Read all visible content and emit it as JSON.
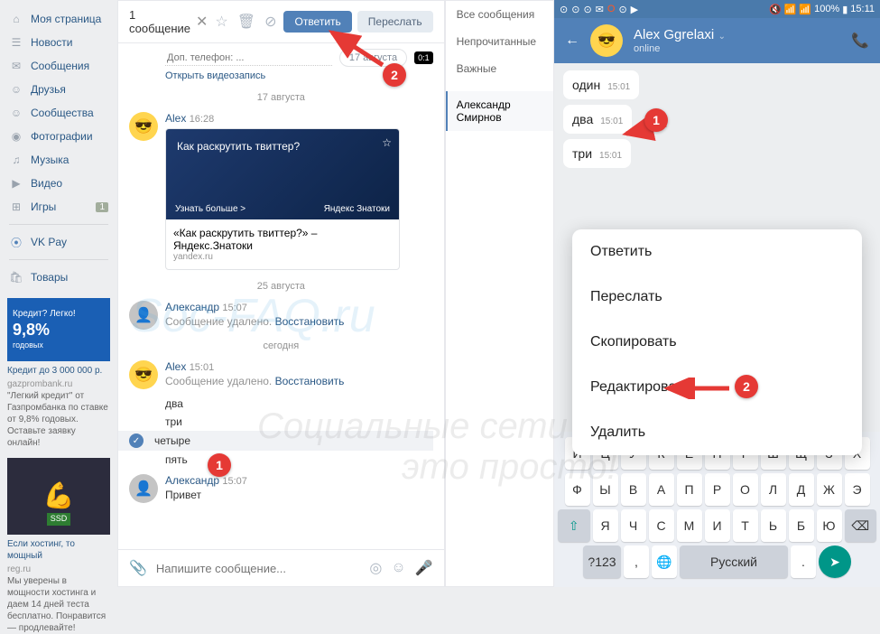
{
  "sidebar": {
    "items": [
      {
        "icon": "home",
        "label": "Моя страница"
      },
      {
        "icon": "news",
        "label": "Новости"
      },
      {
        "icon": "msg",
        "label": "Сообщения"
      },
      {
        "icon": "friends",
        "label": "Друзья"
      },
      {
        "icon": "groups",
        "label": "Сообщества"
      },
      {
        "icon": "photo",
        "label": "Фотографии"
      },
      {
        "icon": "music",
        "label": "Музыка"
      },
      {
        "icon": "video",
        "label": "Видео"
      },
      {
        "icon": "games",
        "label": "Игры",
        "badge": "1"
      }
    ],
    "vkpay": "VK Pay",
    "goods": "Товары"
  },
  "ad1": {
    "badge_top": "Кредит? Легко!",
    "badge_rate": "9,8%",
    "badge_sub": "годовых",
    "title": "Кредит до 3 000 000 р.",
    "domain": "gazprombank.ru",
    "text": "\"Легкий кредит\" от Газпромбанка по ставке от 9,8% годовых. Оставьте заявку онлайн!"
  },
  "ad2": {
    "ssd": "SSD",
    "title": "Если хостинг, то мощный",
    "domain": "reg.ru",
    "text": "Мы уверены в мощности хостинга и даем 14 дней теста бесплатно. Понравится — продлевайте!"
  },
  "topbar": {
    "title": "1 сообщение",
    "reply": "Ответить",
    "forward": "Переслать"
  },
  "phone_placeholder": "Доп. телефон: ...",
  "date_chip": "17 августа",
  "video_link": "Открыть видеозапись",
  "date1": "17 августа",
  "date2": "25 августа",
  "date3": "сегодня",
  "alex": "Alex",
  "alexander": "Александр",
  "t1628": "16:28",
  "t1507": "15:07",
  "t1501": "15:01",
  "card": {
    "headline": "Как раскрутить твиттер?",
    "more": "Узнать больше >",
    "brand": "Яндекс Знатоки",
    "title": "«Как раскрутить твиттер?» – Яндекс.Знатоки",
    "domain": "yandex.ru"
  },
  "deleted": "Сообщение удалено.",
  "restore": "Восстановить",
  "m_dva": "два",
  "m_tri": "три",
  "m_chetyre": "четыре",
  "m_pyat": "пять",
  "m_privet": "Привет",
  "composer_placeholder": "Напишите сообщение...",
  "rp": {
    "all": "Все сообщения",
    "unread": "Непрочитанные",
    "important": "Важные",
    "name": "Александр Смирнов"
  },
  "mobile": {
    "battery": "100%",
    "time": "15:11",
    "name": "Alex Ggrelaxi",
    "status": "online",
    "b1": "один",
    "b2": "два",
    "b3": "три",
    "bt": "15:01",
    "menu": [
      "Ответить",
      "Переслать",
      "Скопировать",
      "Редактировать",
      "Удалить"
    ],
    "kb_row1": [
      "Й",
      "Ц",
      "У",
      "К",
      "Е",
      "Н",
      "Г",
      "Ш",
      "Щ",
      "З",
      "Х"
    ],
    "kb_row2": [
      "Ф",
      "Ы",
      "В",
      "А",
      "П",
      "Р",
      "О",
      "Л",
      "Д",
      "Ж",
      "Э"
    ],
    "kb_row3": [
      "Я",
      "Ч",
      "С",
      "М",
      "И",
      "Т",
      "Ь",
      "Б",
      "Ю"
    ],
    "k123": "?123",
    "lang": "Русский",
    "comma": ",",
    "dot": "."
  },
  "wm1": "Soc-FAQ.ru",
  "wm2": "Социальные сети",
  "wm3": "это просто!"
}
